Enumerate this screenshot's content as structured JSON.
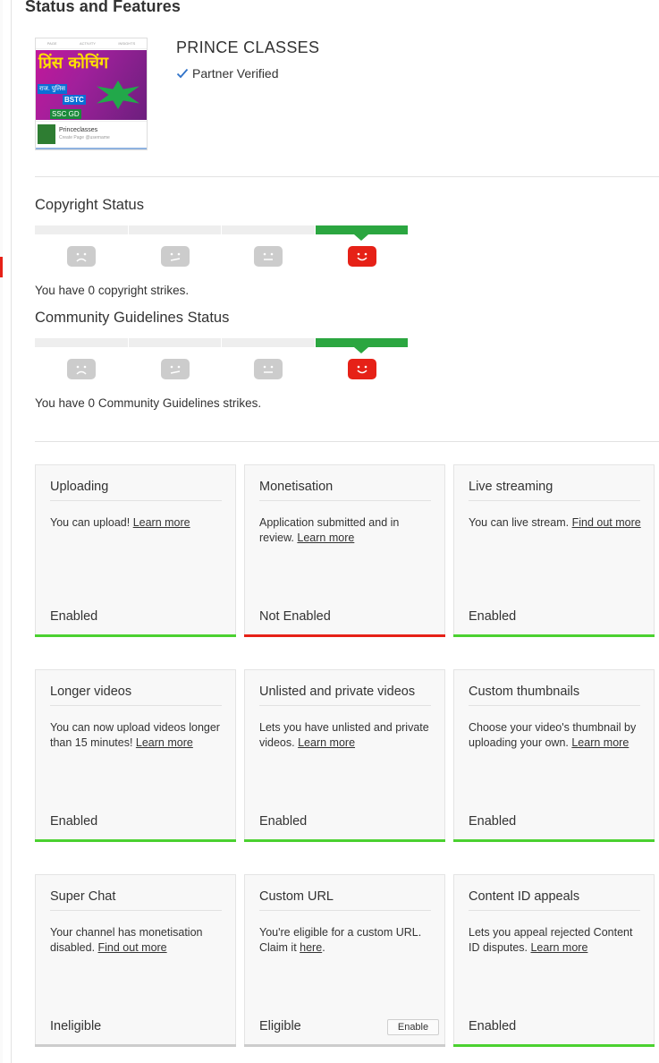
{
  "page_title": "Status and Features",
  "channel": {
    "name": "PRINCE CLASSES",
    "verified_label": "Partner Verified",
    "thumbnail": {
      "tabs": [
        "PAGE",
        "ACTIVITY",
        "INSIGHTS"
      ],
      "page_name": "Princeclasses",
      "page_sub": "Create Page @username"
    }
  },
  "copyright": {
    "title": "Copyright Status",
    "text": "You have 0 copyright strikes."
  },
  "community": {
    "title": "Community Guidelines Status",
    "text": "You have 0 Community Guidelines strikes."
  },
  "features": [
    {
      "title": "Uploading",
      "desc": "You can upload!",
      "link": "Learn more",
      "desc_after": "",
      "state": "Enabled",
      "status": "green"
    },
    {
      "title": "Monetisation",
      "desc": "Application submitted and in review.",
      "link": "Learn more",
      "desc_after": "",
      "state": "Not Enabled",
      "status": "red"
    },
    {
      "title": "Live streaming",
      "desc": "You can live stream.",
      "link": "Find out more",
      "desc_after": "",
      "state": "Enabled",
      "status": "green"
    },
    {
      "title": "Longer videos",
      "desc": "You can now upload videos longer than 15 minutes!",
      "link": "Learn more",
      "desc_after": "",
      "state": "Enabled",
      "status": "green"
    },
    {
      "title": "Unlisted and private videos",
      "desc": "Lets you have unlisted and private videos.",
      "link": "Learn more",
      "desc_after": "",
      "state": "Enabled",
      "status": "green"
    },
    {
      "title": "Custom thumbnails",
      "desc": "Choose your video's thumbnail by uploading your own.",
      "link": "Learn more",
      "desc_after": "",
      "state": "Enabled",
      "status": "green"
    },
    {
      "title": "Super Chat",
      "desc": "Your channel has monetisation disabled.",
      "link": "Find out more",
      "desc_after": "",
      "state": "Ineligible",
      "status": "grey"
    },
    {
      "title": "Custom URL",
      "desc": "You're eligible for a custom URL. Claim it",
      "link": "here",
      "desc_after": ".",
      "state": "Eligible",
      "status": "grey",
      "button": "Enable"
    },
    {
      "title": "Content ID appeals",
      "desc": "Lets you appeal rejected Content ID disputes.",
      "link": "Learn more",
      "desc_after": "",
      "state": "Enabled",
      "status": "green"
    }
  ],
  "colors": {
    "enabled": "#4bd130",
    "not_enabled": "#e62117",
    "neutral": "#cccccc",
    "strike_ok": "#2ba640"
  }
}
